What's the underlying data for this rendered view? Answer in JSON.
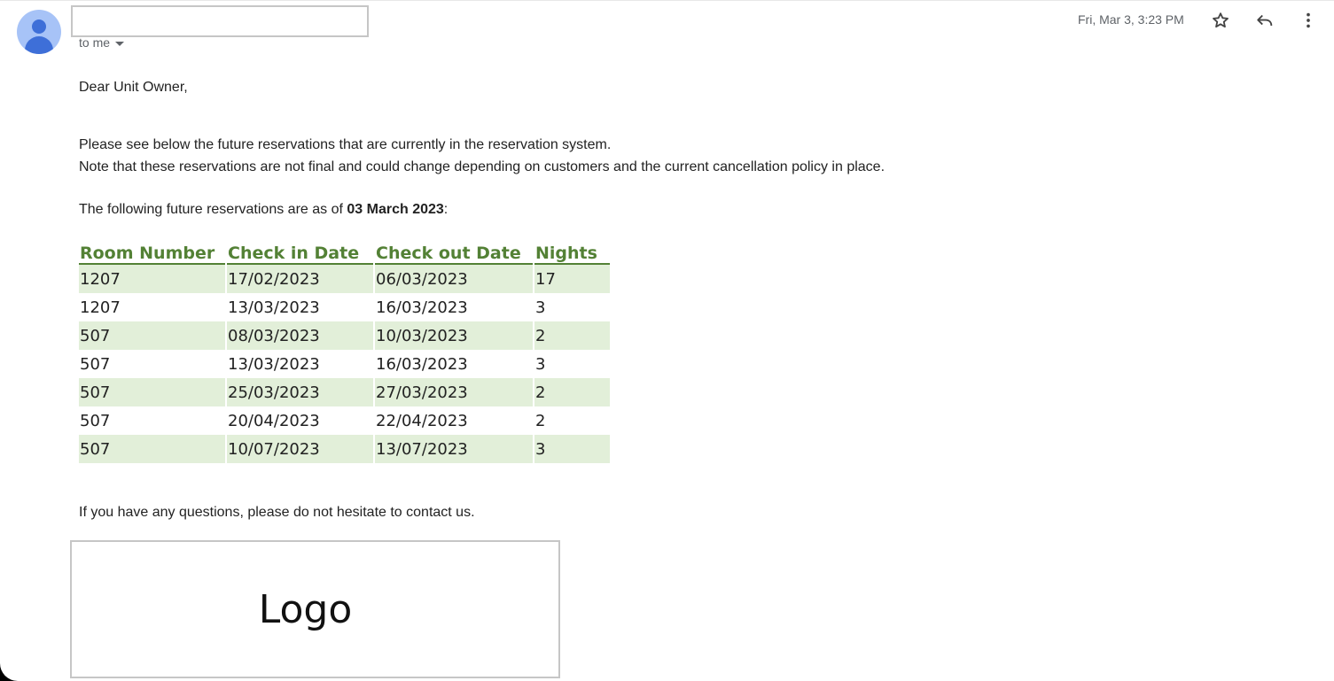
{
  "header": {
    "to_label": "to me",
    "date": "Fri, Mar 3, 3:23 PM"
  },
  "icons": {
    "avatar": "avatar-person-icon",
    "star": "star-icon",
    "reply": "reply-arrow-icon",
    "more": "more-vert-icon"
  },
  "colors": {
    "table_header": "#538135",
    "row_shade": "#e2efd9",
    "avatar_bg": "#a7c3f7",
    "avatar_fg": "#3e6fd8"
  },
  "message": {
    "greeting": "Dear Unit Owner,",
    "line1": "Please see below the future reservations that are currently in the reservation system.",
    "line2": "Note that these reservations are not final and could change depending on customers and the current cancellation policy in place.",
    "asof_prefix": "The following future reservations are as of ",
    "asof_date": "03 March 2023",
    "asof_suffix": ":",
    "closing": "If you have any questions, please do not hesitate to contact us.",
    "logo_text": "Logo"
  },
  "table": {
    "headers": [
      "Room Number",
      "Check in Date",
      "Check out Date",
      "Nights"
    ],
    "rows": [
      [
        "1207",
        "17/02/2023",
        "06/03/2023",
        "17"
      ],
      [
        "1207",
        "13/03/2023",
        "16/03/2023",
        "3"
      ],
      [
        "507",
        "08/03/2023",
        "10/03/2023",
        "2"
      ],
      [
        "507",
        "13/03/2023",
        "16/03/2023",
        "3"
      ],
      [
        "507",
        "25/03/2023",
        "27/03/2023",
        "2"
      ],
      [
        "507",
        "20/04/2023",
        "22/04/2023",
        "2"
      ],
      [
        "507",
        "10/07/2023",
        "13/07/2023",
        "3"
      ]
    ]
  }
}
